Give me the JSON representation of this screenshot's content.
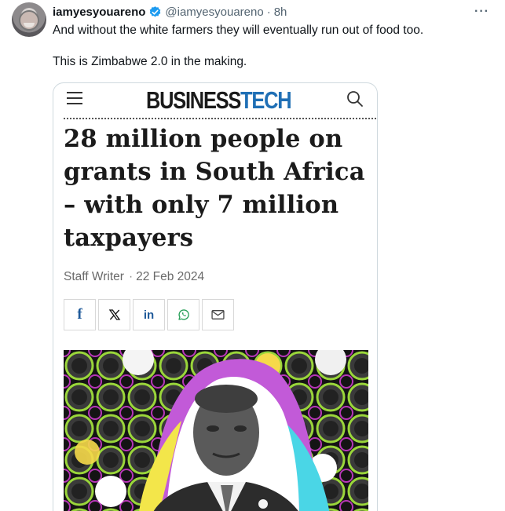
{
  "tweet": {
    "display_name": "iamyesyouareno",
    "handle": "@iamyesyouareno",
    "separator": "·",
    "time": "8h",
    "more_icon": "more-horizontal-icon",
    "verified_color": "#1d9bf0",
    "lines": [
      "And without the white farmers they will eventually run out of food too.",
      "This is Zimbabwe 2.0 in the making."
    ]
  },
  "card": {
    "logo_part1": "BUSINESS",
    "logo_part2": "TECH",
    "logo_accent": "#1f6fb5",
    "headline": "28 million people on grants in South Africa – with only 7 million taxpayers",
    "author": "Staff Writer",
    "byline_sep": "·",
    "date": "22 Feb 2024",
    "share_buttons": [
      {
        "name": "facebook",
        "label": "f",
        "icon": "facebook-icon"
      },
      {
        "name": "x",
        "label": "𝕏",
        "icon": "x-icon"
      },
      {
        "name": "linkedin",
        "label": "in",
        "icon": "linkedin-icon"
      },
      {
        "name": "whatsapp",
        "label": "",
        "icon": "whatsapp-icon"
      },
      {
        "name": "email",
        "label": "",
        "icon": "mail-icon"
      }
    ]
  }
}
